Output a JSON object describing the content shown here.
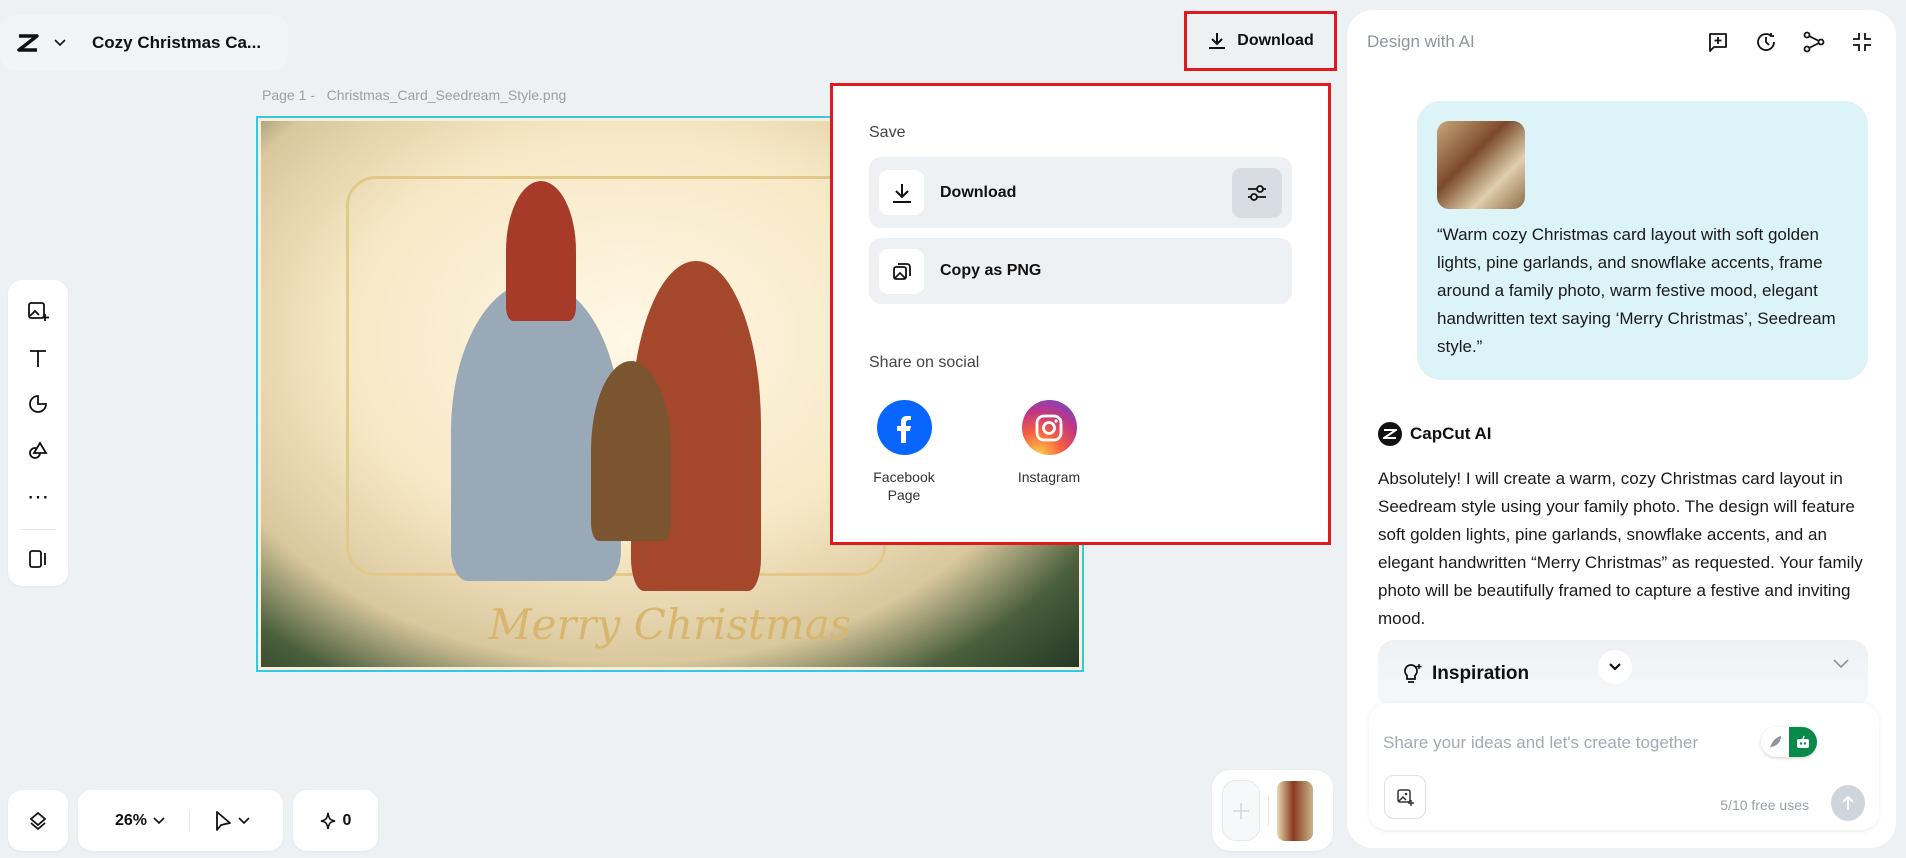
{
  "header": {
    "doc_title": "Cozy Christmas Ca...",
    "download_label": "Download"
  },
  "canvas": {
    "page_label": "Page 1 -",
    "file_name": "Christmas_Card_Seedream_Style.png",
    "card_text": "Merry Christmas"
  },
  "popup": {
    "save_heading": "Save",
    "download_label": "Download",
    "copy_label": "Copy as PNG",
    "share_heading": "Share on social",
    "socials": [
      {
        "label": "Facebook Page",
        "color": "#0866ff"
      },
      {
        "label": "Instagram",
        "color": "#e1306c"
      }
    ]
  },
  "toolbar": {
    "zoom": "26%",
    "credits": "0"
  },
  "panel": {
    "title": "Design with AI",
    "user_prompt": "“Warm cozy Christmas card layout with soft golden lights, pine garlands, and snowflake accents, frame around a family photo, warm festive mood, elegant handwritten text saying ‘Merry Christmas’, Seedream style.”",
    "ai_name": "CapCut AI",
    "ai_reply": "Absolutely! I will create a warm, cozy Christmas card layout in Seedream style using your family photo. The design will feature soft golden lights, pine garlands, snowflake accents, and an elegant handwritten “Merry Christmas” as requested. Your family photo will be beautifully framed to capture a festive and inviting mood.",
    "inspiration": "Inspiration",
    "input_placeholder": "Share your ideas and let's create together",
    "free_uses": "5/10 free uses"
  },
  "colors": {
    "highlight": "#e0191e",
    "selection": "#35c8e0",
    "bubble": "#dcf3f7",
    "agent_toggle": "#0a8a4a"
  }
}
